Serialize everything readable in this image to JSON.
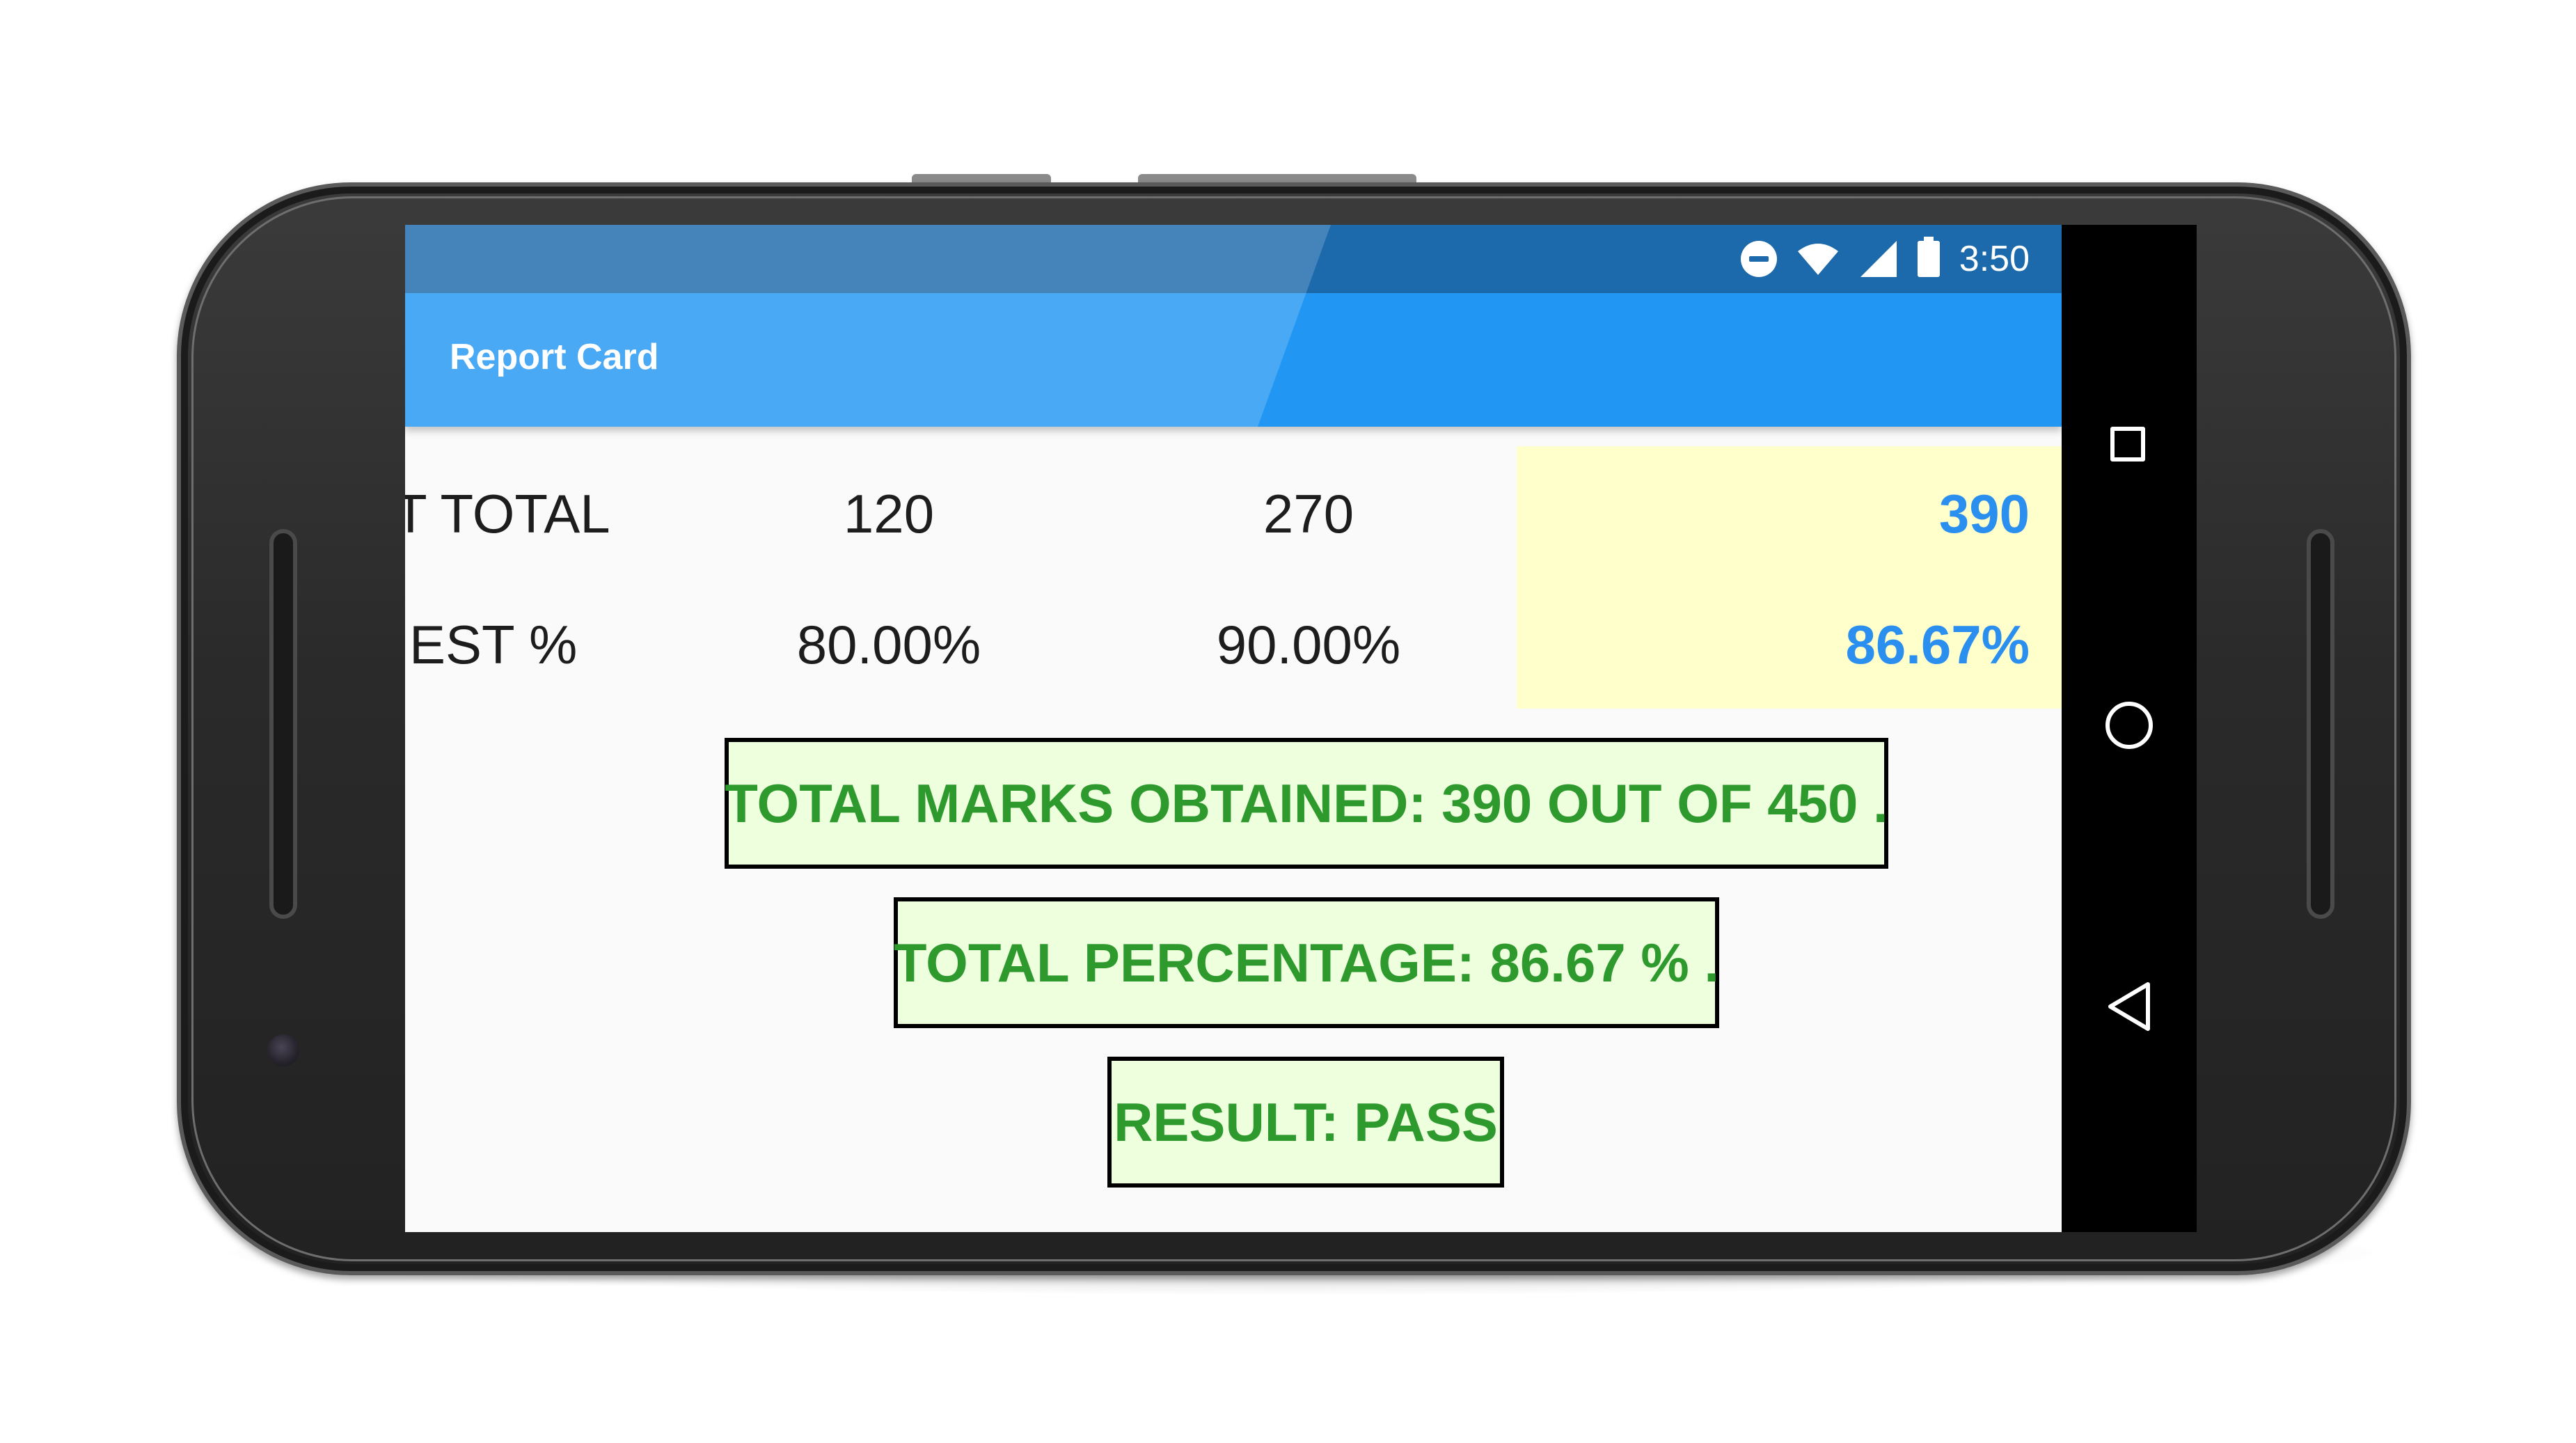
{
  "status_bar": {
    "time": "3:50",
    "icons": [
      "do-not-disturb-icon",
      "wifi-icon",
      "cell-signal-icon",
      "battery-icon"
    ]
  },
  "app_bar": {
    "title": "Report Card"
  },
  "table": {
    "rows": [
      {
        "label": "T TOTAL",
        "col1": "120",
        "col2": "270",
        "total": "390"
      },
      {
        "label": "EST %",
        "col1": "80.00%",
        "col2": "90.00%",
        "total": "86.67%"
      }
    ]
  },
  "summary": {
    "total_marks": "TOTAL MARKS OBTAINED: 390 OUT OF 450 .",
    "total_percentage": "TOTAL PERCENTAGE: 86.67 % .",
    "result": "RESULT: PASS"
  },
  "nav_bar": {
    "buttons": [
      "recents-square-icon",
      "home-circle-icon",
      "back-triangle-icon"
    ]
  },
  "colors": {
    "status_bar": "#1c6aab",
    "app_bar": "#2196f3",
    "highlight_column": "#ffffcc",
    "total_text": "#2b8ff0",
    "summary_background": "#eeffdd",
    "summary_text": "#2e9a2e"
  }
}
